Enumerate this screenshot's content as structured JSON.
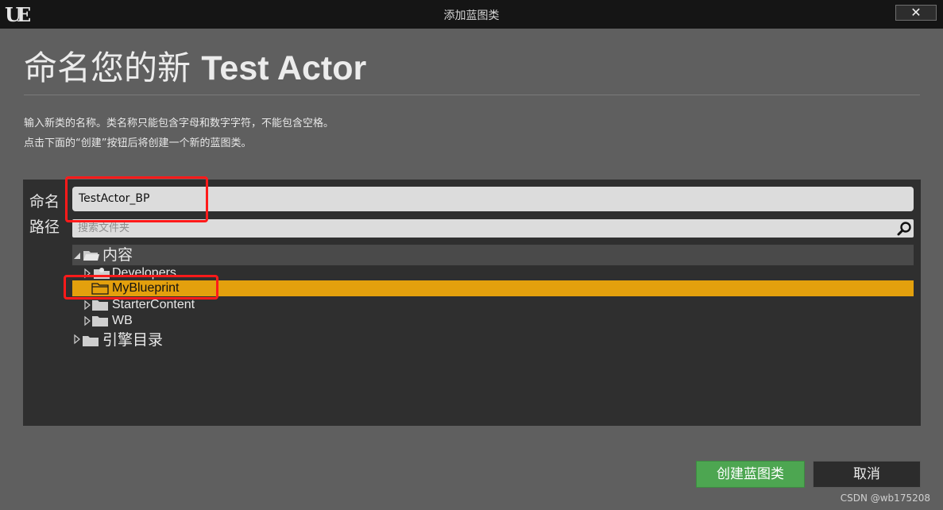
{
  "window": {
    "title": "添加蓝图类",
    "close_label": "✕"
  },
  "heading": {
    "prefix": "命名您的新 ",
    "class_name": "Test Actor"
  },
  "description": {
    "line1": "输入新类的名称。类名称只能包含字母和数字字符，不能包含空格。",
    "line2": "点击下面的“创建”按钮后将创建一个新的蓝图类。"
  },
  "form": {
    "name_label": "命名",
    "path_label": "路径",
    "name_value": "TestActor_BP",
    "search_placeholder": "搜索文件夹"
  },
  "tree": {
    "root": {
      "label": "内容",
      "expanded": true
    },
    "children": [
      {
        "label": "Developers",
        "icon": "developer-folder-icon",
        "selected": false
      },
      {
        "label": "MyBlueprint",
        "icon": "folder-icon",
        "selected": true
      },
      {
        "label": "StarterContent",
        "icon": "folder-icon",
        "selected": false
      },
      {
        "label": "WB",
        "icon": "folder-icon",
        "selected": false
      }
    ],
    "engine": {
      "label": "引擎目录",
      "expanded": false
    }
  },
  "buttons": {
    "create": "创建蓝图类",
    "cancel": "取消"
  },
  "watermark": "CSDN @wb175208",
  "colors": {
    "selection": "#e3a00d",
    "create_button": "#4da651",
    "highlight_box": "#ff1a1a"
  }
}
